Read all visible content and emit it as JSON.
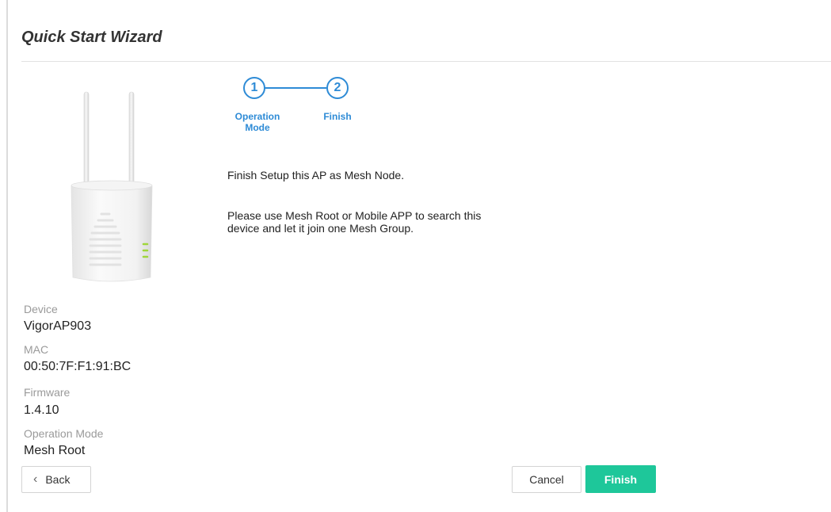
{
  "header": {
    "title": "Quick Start Wizard"
  },
  "stepper": {
    "steps": [
      {
        "number": "1",
        "label_line1": "Operation",
        "label_line2": "Mode"
      },
      {
        "number": "2",
        "label_line1": "Finish",
        "label_line2": ""
      }
    ],
    "color": "#2e8bd6"
  },
  "main": {
    "line1": "Finish Setup this AP as Mesh Node.",
    "line2a": "Please use Mesh Root or Mobile APP to search this",
    "line2b": "device and let it join one Mesh Group."
  },
  "device_info": {
    "device_label": "Device",
    "device_value": "VigorAP903",
    "mac_label": "MAC",
    "mac_value": "00:50:7F:F1:91:BC",
    "firmware_label": "Firmware",
    "firmware_value": "1.4.10",
    "mode_label": "Operation Mode",
    "mode_value": "Mesh Root"
  },
  "buttons": {
    "back_icon": "chevron-left-icon",
    "back": "Back",
    "cancel": "Cancel",
    "finish": "Finish",
    "finish_color": "#1ec79a"
  }
}
